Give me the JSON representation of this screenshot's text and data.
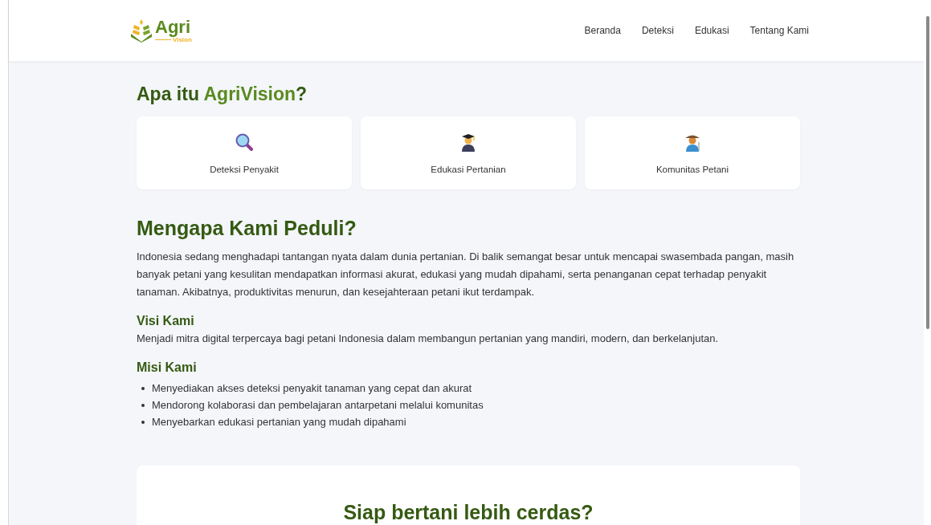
{
  "header": {
    "logo": {
      "name": "Agri",
      "tagline": "Vision"
    },
    "nav": [
      {
        "label": "Beranda"
      },
      {
        "label": "Deteksi"
      },
      {
        "label": "Edukasi"
      },
      {
        "label": "Tentang Kami"
      }
    ]
  },
  "intro": {
    "title_prefix": "Apa itu ",
    "title_highlight": "AgriVision",
    "title_suffix": "?",
    "features": [
      {
        "kind": "search",
        "label": "Deteksi Penyakit"
      },
      {
        "kind": "graduate",
        "label": "Edukasi Pertanian"
      },
      {
        "kind": "farmer",
        "label": "Komunitas Petani"
      }
    ]
  },
  "about": {
    "title": "Mengapa Kami Peduli?",
    "paragraph": "Indonesia sedang menghadapi tantangan nyata dalam dunia pertanian. Di balik semangat besar untuk mencapai swasembada pangan, masih banyak petani yang kesulitan mendapatkan informasi akurat, edukasi yang mudah dipahami, serta penanganan cepat terhadap penyakit tanaman. Akibatnya, produktivitas menurun, dan kesejahteraan petani ikut terdampak.",
    "vision_title": "Visi Kami",
    "vision_text": "Menjadi mitra digital terpercaya bagi petani Indonesia dalam membangun pertanian yang mandiri, modern, dan berkelanjutan.",
    "mission_title": "Misi Kami",
    "missions": [
      "Menyediakan akses deteksi penyakit tanaman yang cepat dan akurat",
      "Mendorong kolaborasi dan pembelajaran antarpetani melalui komunitas",
      "Menyebarkan edukasi pertanian yang mudah dipahami"
    ]
  },
  "cta": {
    "title": "Siap bertani lebih cerdas?"
  }
}
